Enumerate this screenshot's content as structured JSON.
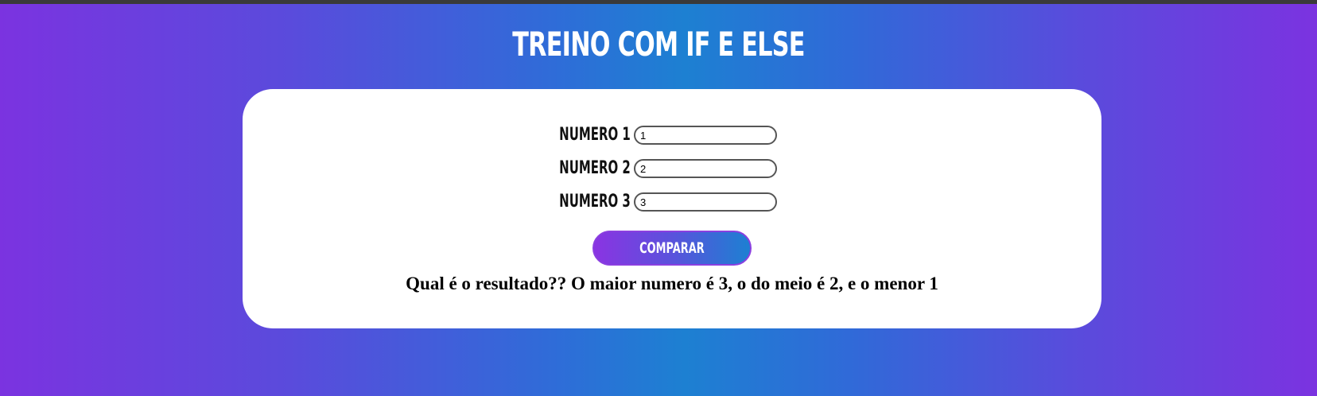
{
  "page": {
    "title": "TREINO COM IF E ELSE"
  },
  "form": {
    "fields": [
      {
        "label": "NUMERO 1",
        "value": "1"
      },
      {
        "label": "NUMERO 2",
        "value": "2"
      },
      {
        "label": "NUMERO 3",
        "value": "3"
      }
    ],
    "submit_label": "COMPARAR"
  },
  "result": {
    "text": "Qual é o resultado?? O maior numero é 3, o do meio é 2, e o menor 1"
  },
  "colors": {
    "background_gradient": [
      "#7b33e0",
      "#1d80d2",
      "#7b33e0"
    ],
    "card": "#ffffff",
    "button_gradient": [
      "#8a34e2",
      "#1d80d2"
    ],
    "title_text": "#ffffff"
  }
}
